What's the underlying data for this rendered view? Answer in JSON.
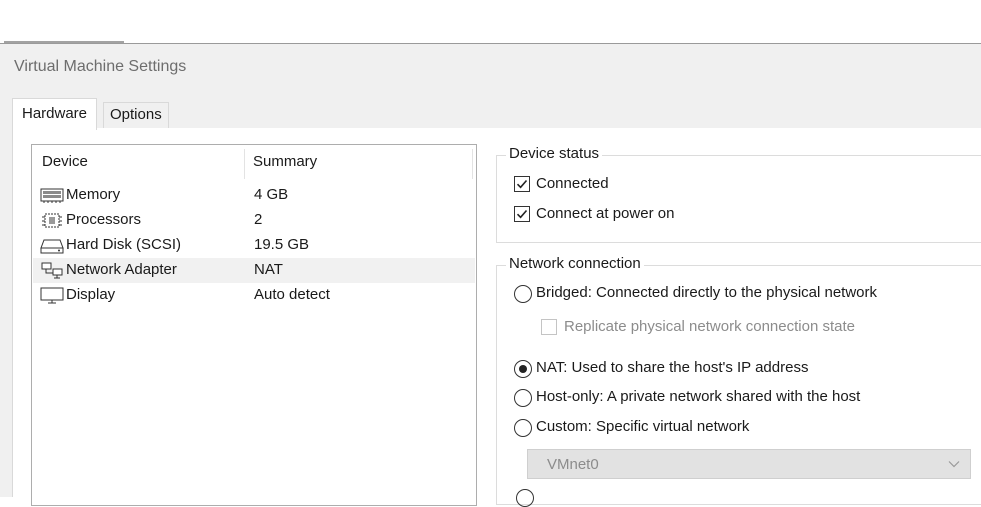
{
  "window": {
    "title": "Virtual Machine Settings"
  },
  "tabs": [
    {
      "label": "Hardware",
      "active": true
    },
    {
      "label": "Options",
      "active": false
    }
  ],
  "device_list": {
    "columns": [
      "Device",
      "Summary"
    ],
    "rows": [
      {
        "name": "Memory",
        "summary": "4 GB",
        "icon": "memory-icon",
        "selected": false
      },
      {
        "name": "Processors",
        "summary": "2",
        "icon": "processor-icon",
        "selected": false
      },
      {
        "name": "Hard Disk (SCSI)",
        "summary": "19.5 GB",
        "icon": "hard-disk-icon",
        "selected": false
      },
      {
        "name": "Network Adapter",
        "summary": "NAT",
        "icon": "network-adapter-icon",
        "selected": true
      },
      {
        "name": "Display",
        "summary": "Auto detect",
        "icon": "display-icon",
        "selected": false
      }
    ]
  },
  "device_status": {
    "label": "Device status",
    "connected": {
      "label": "Connected",
      "checked": true
    },
    "connect_at_power_on": {
      "label": "Connect at power on",
      "checked": true
    }
  },
  "network_connection": {
    "label": "Network connection",
    "bridged": {
      "label": "Bridged: Connected directly to the physical network",
      "selected": false
    },
    "replicate": {
      "label": "Replicate physical network connection state",
      "checked": false,
      "enabled": false
    },
    "nat": {
      "label": "NAT: Used to share the host's IP address",
      "selected": true
    },
    "host_only": {
      "label": "Host-only: A private network shared with the host",
      "selected": false
    },
    "custom": {
      "label": "Custom: Specific virtual network",
      "selected": false
    },
    "custom_network": {
      "value": "VMnet0",
      "enabled": false
    }
  }
}
